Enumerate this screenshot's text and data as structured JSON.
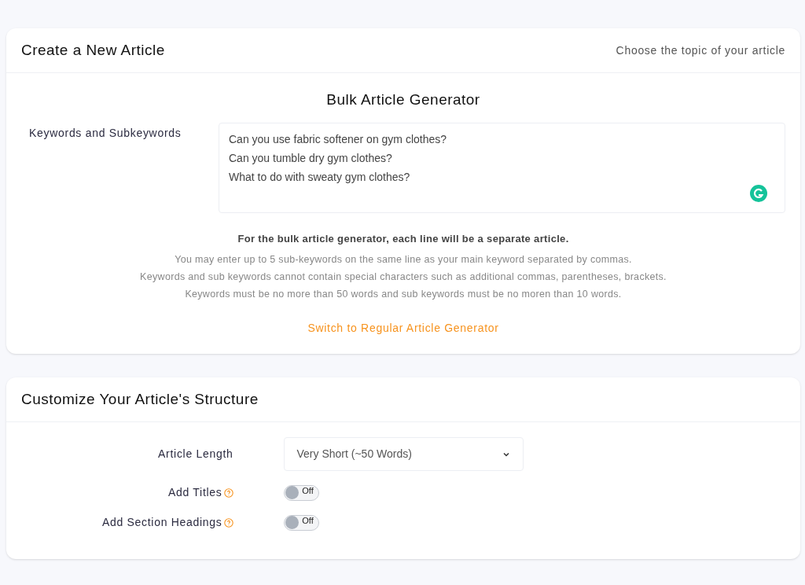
{
  "article_card": {
    "title": "Create a New Article",
    "subtitle": "Choose the topic of your article",
    "generator_title": "Bulk Article Generator",
    "keywords_label": "Keywords and Subkeywords",
    "keywords_lines": [
      "Can you use fabric softener on gym clothes?",
      "Can you tumble dry gym clothes?",
      "What to do with sweaty gym clothes?"
    ],
    "notice": "For the bulk article generator, each line will be a separate article.",
    "hints": [
      "You may enter up to 5 sub-keywords on the same line as your main keyword separated by commas.",
      "Keywords and sub keywords cannot contain special characters such as additional commas, parentheses, brackets.",
      "Keywords must be no more than 50 words and sub keywords must be no moren than 10 words."
    ],
    "switch_link": "Switch to Regular Article Generator"
  },
  "structure_card": {
    "title": "Customize Your Article's Structure",
    "settings": [
      {
        "kind": "select",
        "label": "Article Length",
        "value": "Very Short (~50 Words)"
      },
      {
        "kind": "toggle",
        "label": "Add Titles",
        "help": true,
        "on": false,
        "state_text": "Off"
      },
      {
        "kind": "toggle",
        "label": "Add Section Headings",
        "help": true,
        "on": false,
        "state_text": "Off"
      }
    ]
  }
}
